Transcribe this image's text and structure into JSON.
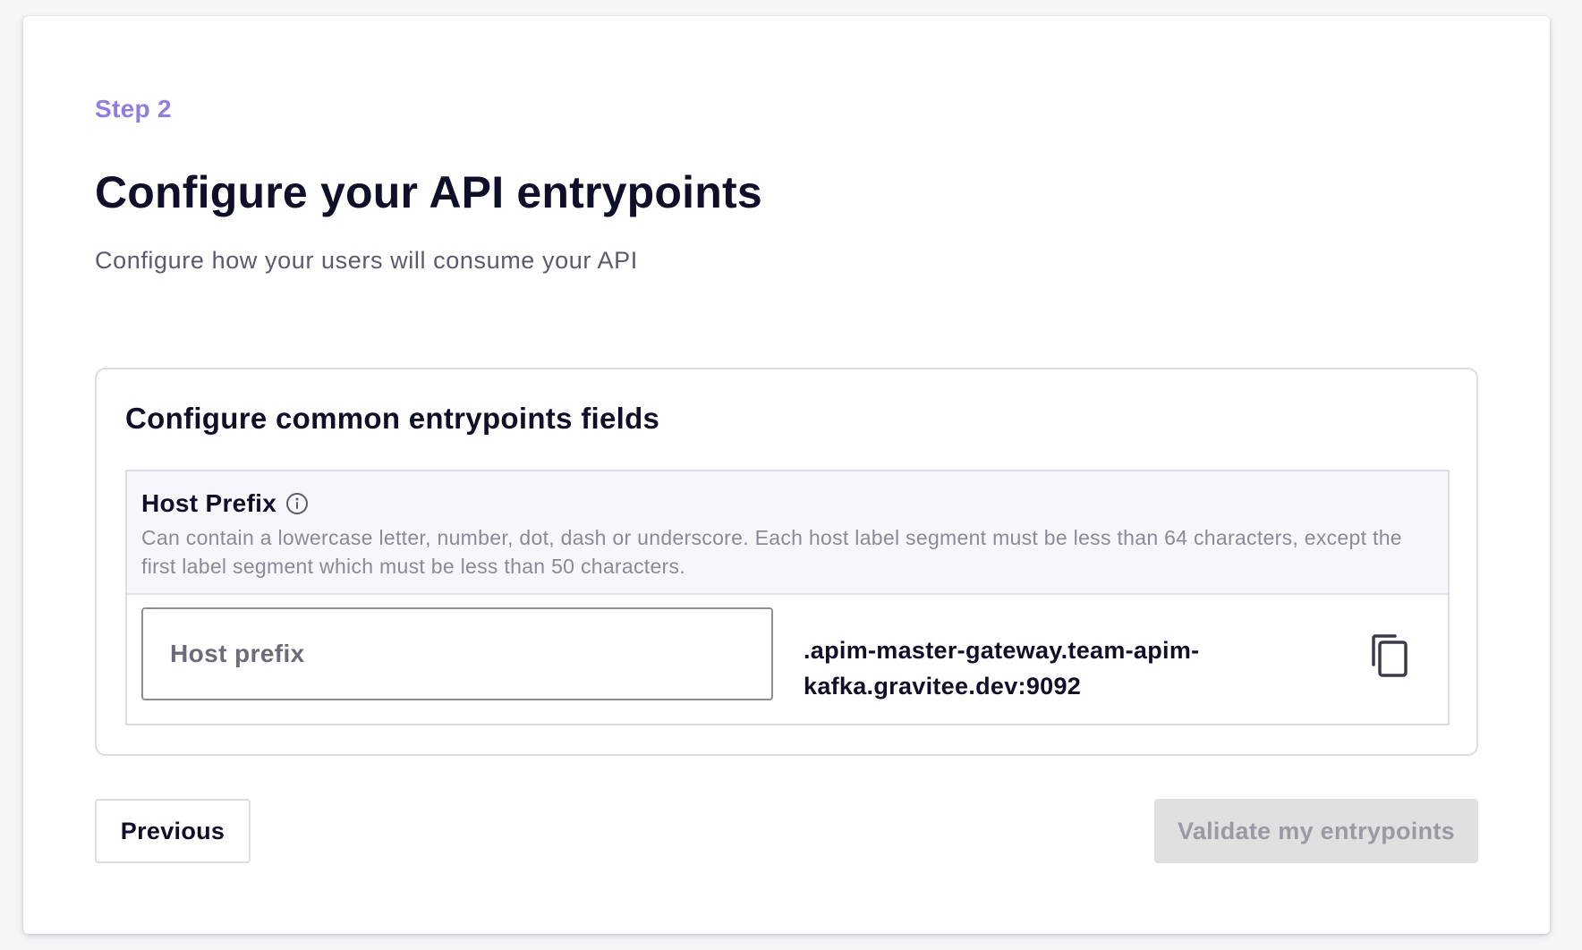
{
  "header": {
    "step_label": "Step 2",
    "title": "Configure your API entrypoints",
    "subtitle": "Configure how your users will consume your API"
  },
  "section": {
    "title": "Configure common entrypoints fields",
    "host_prefix_field": {
      "label": "Host Prefix",
      "info_icon": "info-circle-icon",
      "description": "Can contain a lowercase letter, number, dot, dash or underscore. Each host label segment must be less than 64 characters, except the first label segment which must be less than 50 characters.",
      "input_value": "",
      "input_placeholder": "Host prefix",
      "host_suffix": ".apim-master-gateway.team-apim-kafka.gravitee.dev:9092",
      "copy_icon": "copy-icon"
    }
  },
  "actions": {
    "previous_label": "Previous",
    "validate_label": "Validate my entrypoints",
    "validate_disabled": true
  },
  "colors": {
    "accent": "#8f7ee0",
    "text_primary": "#0f0f29",
    "text_secondary": "#5a5a70",
    "text_muted": "#8a8a98",
    "border": "#dcdce3",
    "disabled_bg": "#e0e0e0",
    "disabled_text": "#9a9aa3"
  }
}
